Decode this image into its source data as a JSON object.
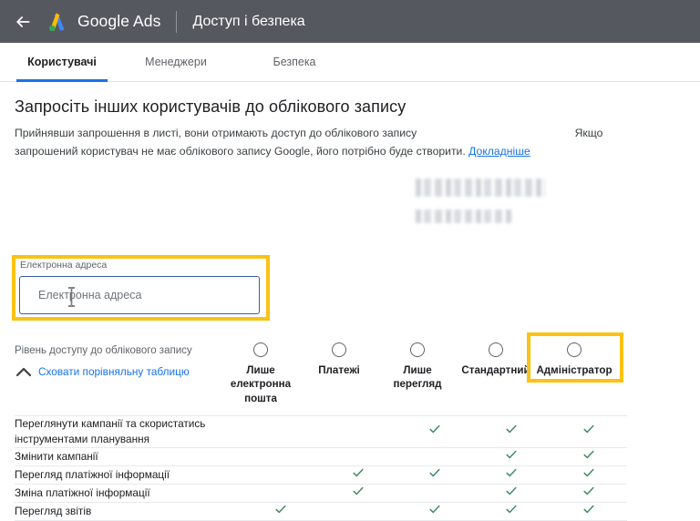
{
  "header": {
    "back_icon": "arrow-left-icon",
    "logo_icon": "google-ads-logo",
    "brand": "Google Ads",
    "page_title": "Доступ і безпека",
    "bg_color": "#55585f"
  },
  "tabs": [
    {
      "id": "users",
      "label": "Користувачі",
      "active": true
    },
    {
      "id": "managers",
      "label": "Менеджери",
      "active": false
    },
    {
      "id": "security",
      "label": "Безпека",
      "active": false
    }
  ],
  "invite": {
    "heading": "Запросіть інших користувачів до облікового запису",
    "description_part1": "Прийнявши запрошення в листі, вони отримають доступ до облікового запису",
    "description_part2": "Якщо запрошений користувач не має облікового запису Google, його потрібно буде створити.",
    "learn_more": "Докладніше"
  },
  "email": {
    "label": "Електронна адреса",
    "placeholder": "Електронна адреса",
    "value": "",
    "highlight_color": "#fac213",
    "border_color": "#3b5ca8"
  },
  "access": {
    "label": "Рівень доступу до облікового запису",
    "collapse_label": "Сховати порівняльну таблицю",
    "collapse_icon": "chevron-up-icon",
    "highlight_color": "#fac213",
    "highlighted_column": "Адміністратор",
    "columns": [
      {
        "label": "Лише електронна пошта",
        "selected": false
      },
      {
        "label": "Платежі",
        "selected": false
      },
      {
        "label": "Лише перегляд",
        "selected": false
      },
      {
        "label": "Стандартний",
        "selected": false
      },
      {
        "label": "Адміністратор",
        "selected": false
      }
    ]
  },
  "comparison": {
    "check_glyph": "✓",
    "check_color": "#3f8a63",
    "rows": [
      {
        "feature": "Переглянути кампанії та скористатись інструментами планування",
        "checks": [
          false,
          false,
          true,
          true,
          true
        ]
      },
      {
        "feature": "Змінити кампанії",
        "checks": [
          false,
          false,
          false,
          true,
          true
        ]
      },
      {
        "feature": "Перегляд платіжної інформації",
        "checks": [
          false,
          true,
          true,
          true,
          true
        ]
      },
      {
        "feature": "Зміна платіжної інформації",
        "checks": [
          false,
          true,
          false,
          true,
          true
        ]
      },
      {
        "feature": "Перегляд звітів",
        "checks": [
          true,
          false,
          true,
          true,
          true
        ]
      }
    ]
  }
}
